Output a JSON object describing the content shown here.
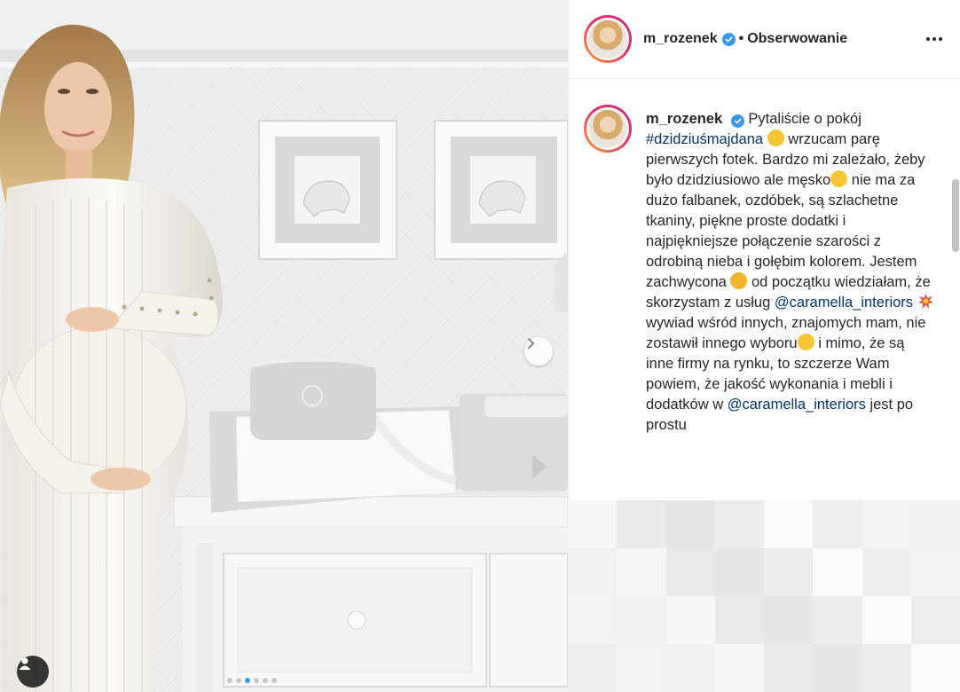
{
  "post": {
    "username": "m_rozenek",
    "follow_separator": "•",
    "follow_label": "Obserwowanie",
    "caption": {
      "username": "m_rozenek",
      "line1": "Pytaliście o pokój",
      "hashtag": "#dzidziuśmajdana",
      "line2": "wrzucam parę pierwszych fotek. Bardzo mi zależało, żeby było dzidziusiowo ale męsko",
      "line3": "nie ma za dużo falbanek, ozdóbek, są szlachetne tkaniny, piękne proste dodatki i najpiękniejsze połączenie szarości z odrobiną nieba i gołębim kolorem. Jestem zachwycona",
      "line4": "od początku wiedziałam, że skorzystam z usług",
      "mention1": "@caramella_interiors",
      "line5": "wywiad wśród innych, znajomych mam, nie zostawił innego wyboru",
      "line6": "i mimo, że są inne firmy na rynku, to szczerze Wam powiem, że jakość wykonania i mebli i dodatków w",
      "mention2": "@caramella_interiors",
      "line7": "jest po prostu"
    }
  },
  "icons": {
    "verified": "verified-badge-icon",
    "more": "more-options-icon",
    "next": "chevron-right-icon",
    "tag": "user-tag-icon",
    "emoji": "grinning-face-emoji"
  },
  "colors": {
    "accent": "#3897f0",
    "text": "#262626",
    "link": "#003569"
  },
  "carousel": {
    "total": 6,
    "active": 2
  }
}
